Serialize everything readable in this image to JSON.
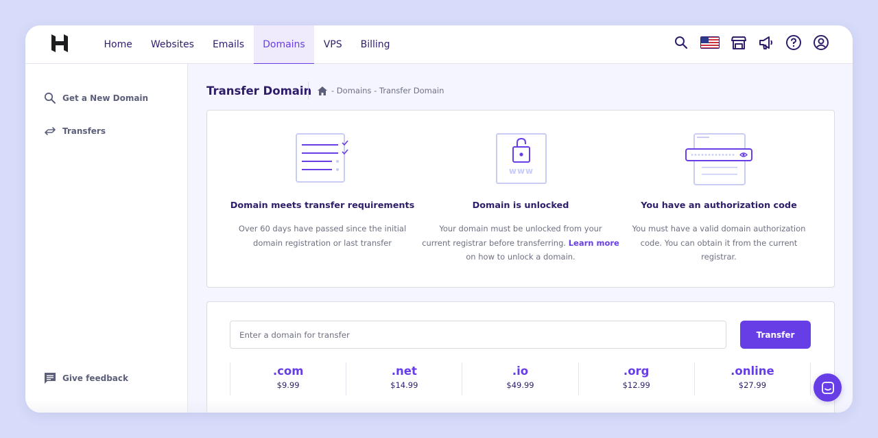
{
  "nav": {
    "items": [
      {
        "label": "Home"
      },
      {
        "label": "Websites"
      },
      {
        "label": "Emails"
      },
      {
        "label": "Domains",
        "active": true
      },
      {
        "label": "VPS"
      },
      {
        "label": "Billing"
      }
    ],
    "icons": [
      "search-icon",
      "us-flag-icon",
      "store-icon",
      "megaphone-icon",
      "help-icon",
      "account-icon"
    ]
  },
  "sidebar": {
    "items": [
      {
        "label": "Get a New Domain",
        "icon": "search-icon"
      },
      {
        "label": "Transfers",
        "icon": "transfer-arrows-icon"
      }
    ],
    "feedback": {
      "label": "Give feedback",
      "icon": "feedback-icon"
    }
  },
  "page": {
    "title": "Transfer Domain",
    "breadcrumb": "- Domains - Transfer Domain"
  },
  "requirements": [
    {
      "title": "Domain meets transfer requirements",
      "line1": "Over 60 days have passed since the initial",
      "line2": "domain registration or last transfer"
    },
    {
      "title": "Domain is unlocked",
      "line1": "Your domain must be unlocked from your",
      "line2_pre": "current registrar before transferring.",
      "link": "Learn more",
      "line3": "on how to unlock a domain."
    },
    {
      "title": "You have an authorization code",
      "line1": "You must have a valid domain authorization",
      "line2": "code. You can obtain it from the current",
      "line3": "registrar."
    }
  ],
  "transfer": {
    "placeholder": "Enter a domain for transfer",
    "button": "Transfer"
  },
  "tlds": [
    {
      "ext": ".com",
      "price": "$9.99"
    },
    {
      "ext": ".net",
      "price": "$14.99"
    },
    {
      "ext": ".io",
      "price": "$49.99"
    },
    {
      "ext": ".org",
      "price": "$12.99"
    },
    {
      "ext": ".online",
      "price": "$27.99"
    }
  ],
  "illustration_text": {
    "www": "www"
  },
  "colors": {
    "accent": "#673de6",
    "text": "#2f1c6a",
    "muted": "#6d7081",
    "background": "#d8dcfa"
  }
}
